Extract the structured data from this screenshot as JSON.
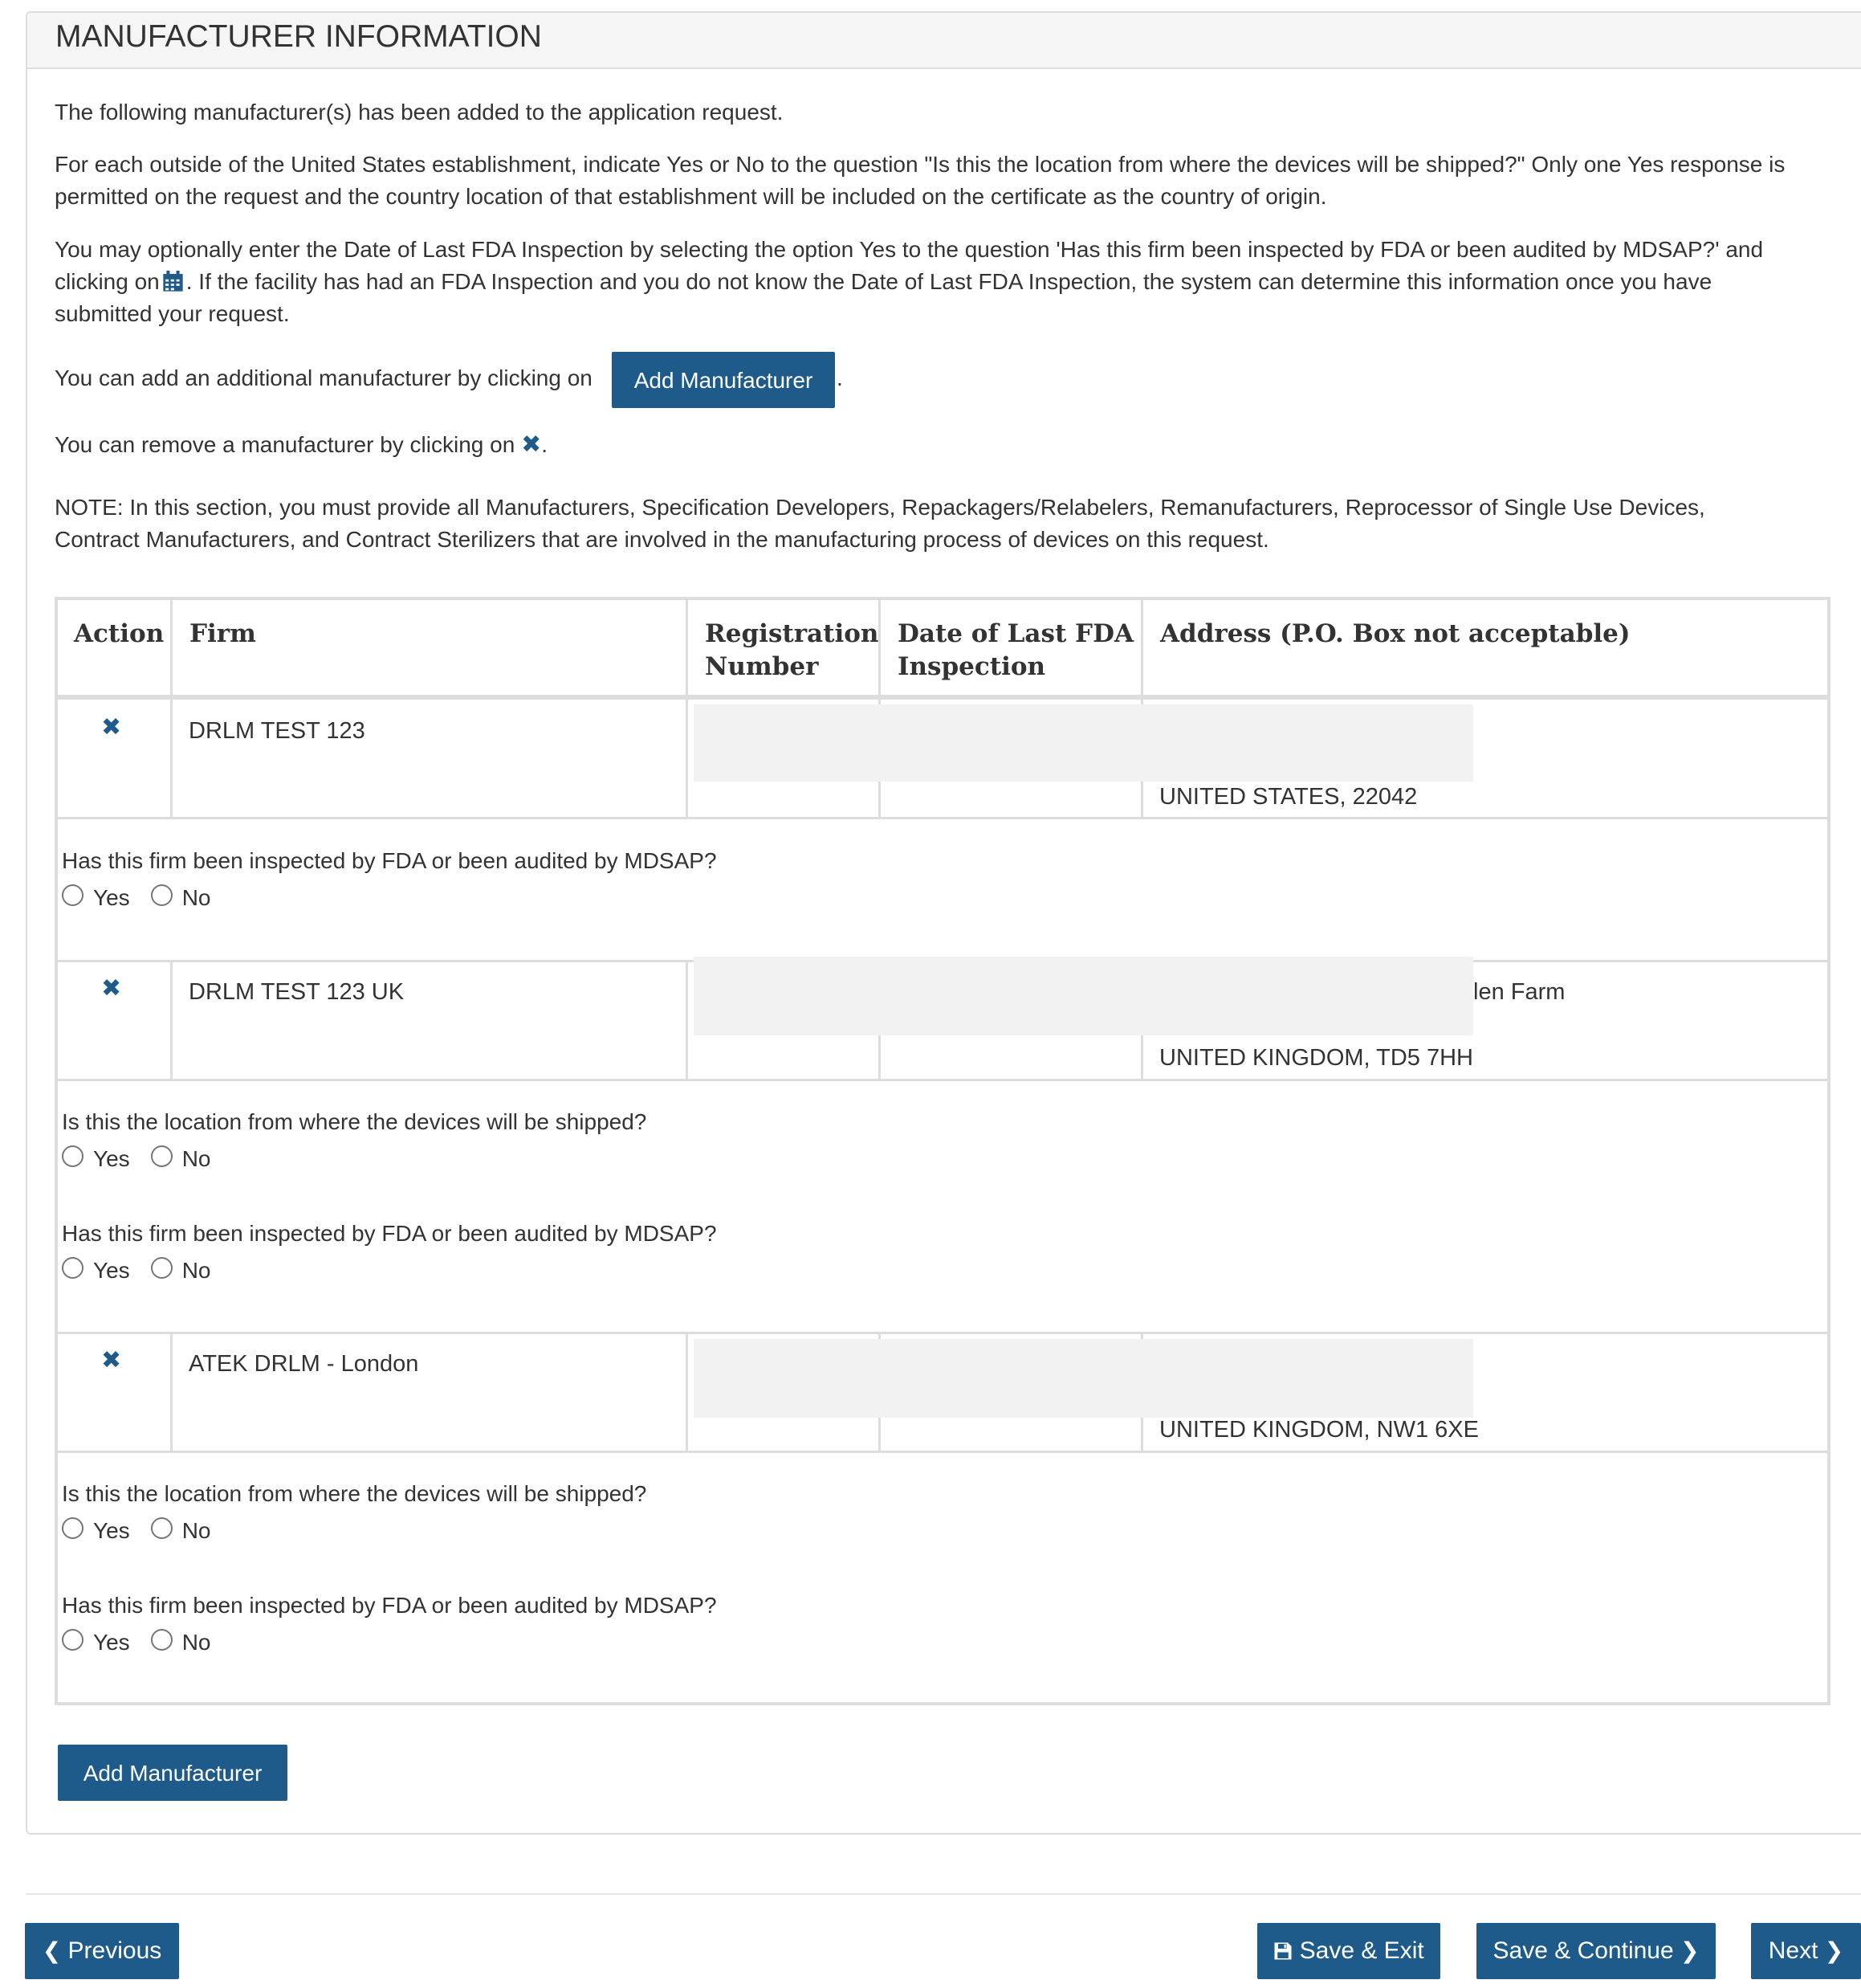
{
  "panel": {
    "title": "MANUFACTURER INFORMATION"
  },
  "intro": {
    "p1": "The following manufacturer(s) has been added to the application request.",
    "p2_line1": "For each outside of the United States establishment, indicate Yes or No to the question \"Is this the location from where the devices will be shipped?\" Only one Yes response is",
    "p2_line2": "permitted on the request and the country location of that establishment will be included on the certificate as the country of origin.",
    "p3_line1": "You may optionally enter the Date of Last FDA Inspection by selecting the option Yes to the question 'Has this firm been inspected by FDA or been audited by MDSAP?' and",
    "p3_line2a": "clicking on",
    "p3_line2b": ". If the facility has had an FDA Inspection and you do not know the Date of Last FDA Inspection, the system can determine this information once you have",
    "p3_line3": "submitted your request.",
    "p4_text": "You can add an additional manufacturer by clicking on",
    "p4_button": "Add Manufacturer",
    "p4_tail": ".",
    "p5_text": "You can remove a manufacturer by clicking on",
    "p5_tail": ".",
    "note_line1": "NOTE: In this section, you must provide all Manufacturers, Specification Developers, Repackagers/Relabelers, Remanufacturers, Reprocessor of Single Use Devices,",
    "note_line2": "Contract Manufacturers, and Contract Sterilizers that are involved in the manufacturing process of devices on this request."
  },
  "table": {
    "headers": {
      "action": "Action",
      "firm": "Firm",
      "reg_line1": "Registration",
      "reg_line2": "Number",
      "date_line1": "Date of Last FDA",
      "date_line2": "Inspection",
      "address": "Address (P.O. Box not acceptable)"
    },
    "rows": [
      {
        "firm": "DRLM TEST 123",
        "address_partial": "",
        "address_last": "UNITED STATES, 22042"
      },
      {
        "firm": "DRLM TEST 123 UK",
        "address_partial": "len Farm",
        "address_last": "UNITED KINGDOM, TD5 7HH"
      },
      {
        "firm": "ATEK DRLM - London",
        "address_partial": "",
        "address_last": "UNITED KINGDOM, NW1 6XE"
      }
    ],
    "q_shipped": "Is this the location from where the devices will be shipped?",
    "q_inspected": "Has this firm been inspected by FDA or been audited by MDSAP?",
    "yes": "Yes",
    "no": "No"
  },
  "add_button": "Add Manufacturer",
  "nav": {
    "previous": "Previous",
    "save_exit": "Save & Exit",
    "save_continue": "Save & Continue",
    "next": "Next"
  },
  "icons": {
    "remove": "close-icon",
    "calendar": "calendar-icon",
    "save": "floppy-disk-icon",
    "prev": "chevron-left-icon",
    "next": "chevron-right-icon"
  },
  "colors": {
    "primary": "#1f5b8a",
    "border": "#dddddd",
    "redacted": "#f2f2f2"
  }
}
